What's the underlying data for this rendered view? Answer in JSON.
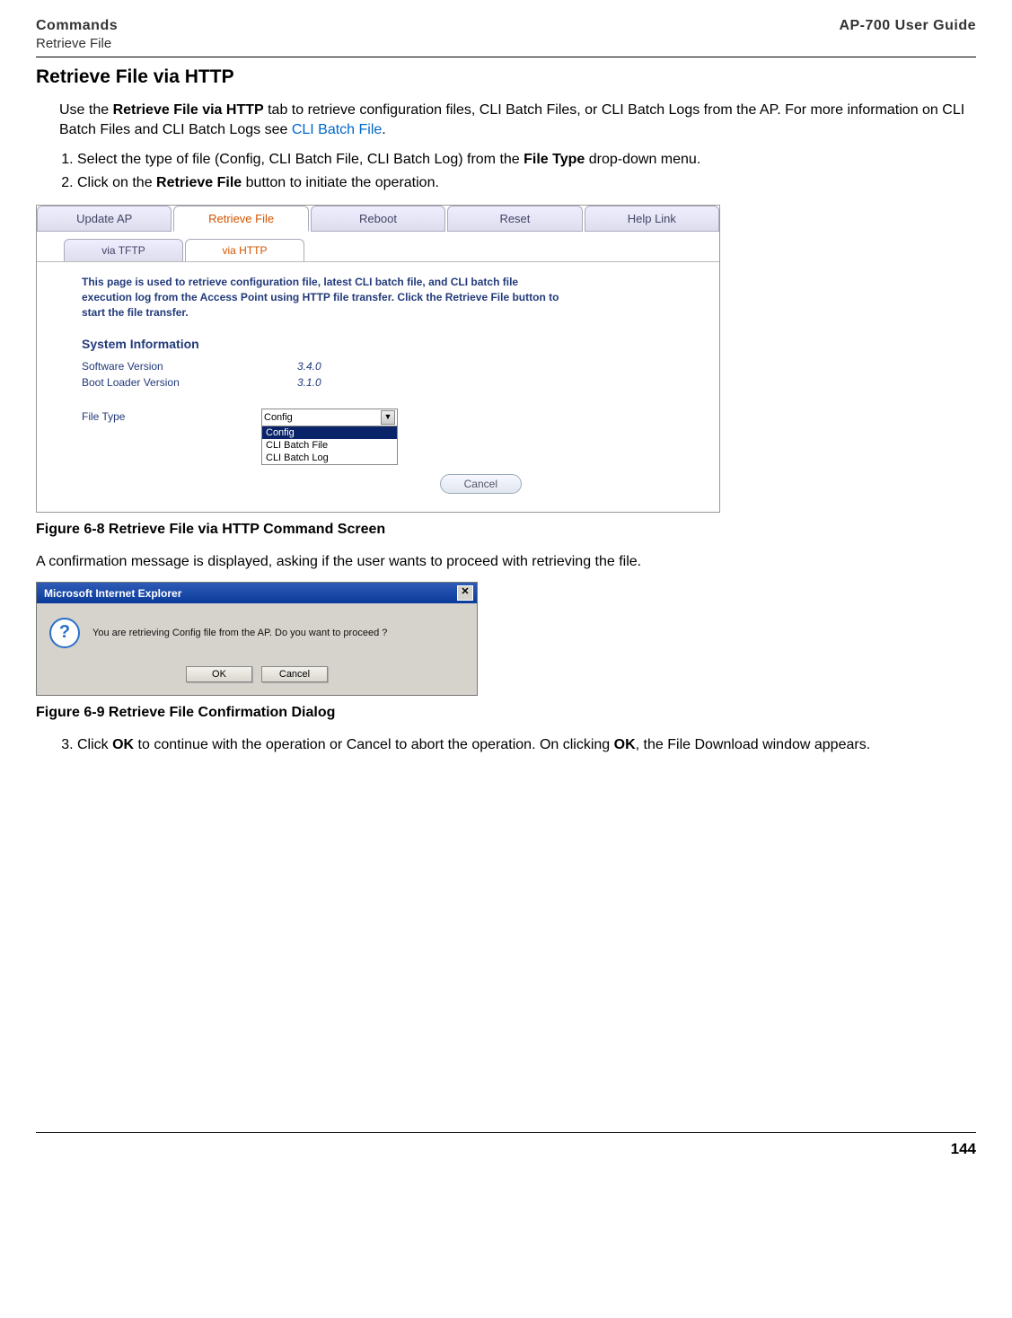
{
  "header": {
    "left_title": "Commands",
    "left_sub": "Retrieve File",
    "right_title": "AP-700 User Guide"
  },
  "section_title": "Retrieve File via HTTP",
  "intro": {
    "part1": "Use the ",
    "bold1": "Retrieve File via HTTP",
    "part2": " tab to retrieve configuration files, CLI Batch Files, or CLI Batch Logs from the AP. For more information on CLI Batch Files and CLI Batch Logs see ",
    "link": "CLI Batch File",
    "part3": "."
  },
  "steps12": {
    "s1a": "Select the type of file (Config, CLI Batch File, CLI Batch Log) from the ",
    "s1b": "File Type",
    "s1c": " drop-down menu.",
    "s2a": "Click on the ",
    "s2b": "Retrieve File",
    "s2c": " button to initiate the operation."
  },
  "shot1": {
    "tabs": [
      "Update AP",
      "Retrieve File",
      "Reboot",
      "Reset",
      "Help Link"
    ],
    "active_tab_index": 1,
    "subtabs": [
      "via TFTP",
      "via HTTP"
    ],
    "active_subtab_index": 1,
    "panel_desc": "This page is used to retrieve configuration file, latest CLI batch file, and CLI batch file execution log from the Access Point using HTTP file transfer. Click the Retrieve File button to start the file transfer.",
    "sys_info_hdr": "System Information",
    "rows": [
      {
        "label": "Software Version",
        "value": "3.4.0"
      },
      {
        "label": "Boot Loader Version",
        "value": "3.1.0"
      }
    ],
    "file_type_label": "File Type",
    "dropdown": {
      "display": "Config",
      "options": [
        "Config",
        "CLI Batch File",
        "CLI Batch Log"
      ],
      "selected_index": 0
    },
    "cancel_label": "Cancel"
  },
  "fig68_caption": "Figure 6-8 Retrieve File via HTTP Command Screen",
  "confirm_text": "A confirmation message is displayed, asking if the user wants to proceed with retrieving the file.",
  "shot2": {
    "title": "Microsoft Internet Explorer",
    "message": "You are retrieving Config file from the AP. Do you want to proceed ?",
    "ok": "OK",
    "cancel": "Cancel"
  },
  "fig69_caption": "Figure 6-9 Retrieve File Confirmation Dialog",
  "step3": {
    "a": "Click ",
    "b": "OK",
    "c": " to continue with the operation or Cancel to abort the operation. On clicking ",
    "d": "OK",
    "e": ", the File Download window appears."
  },
  "page_number": "144"
}
